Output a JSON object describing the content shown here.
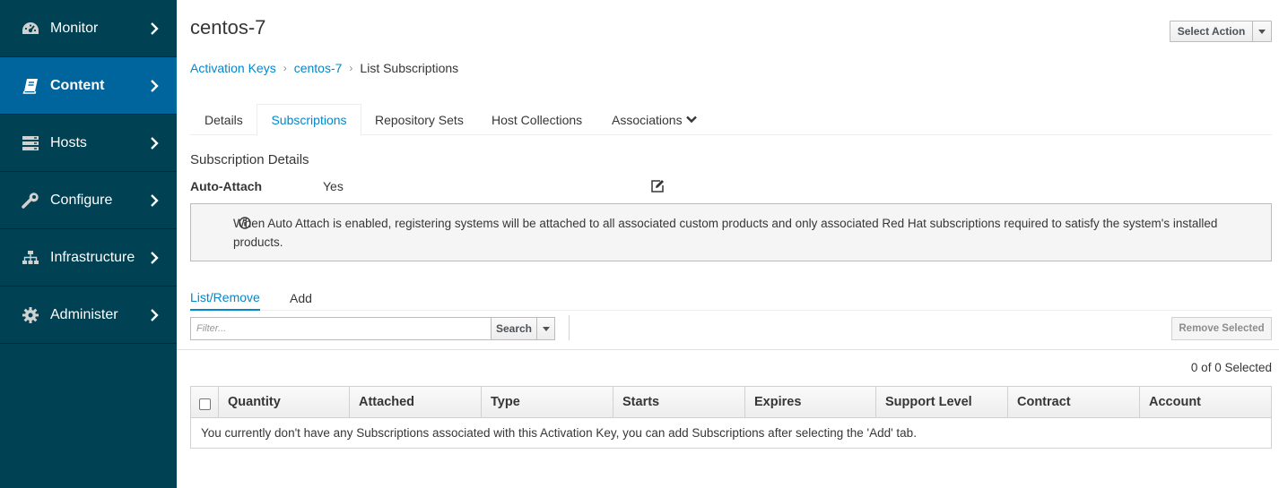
{
  "sidebar": {
    "items": [
      {
        "label": "Monitor",
        "icon": "dashboard-icon"
      },
      {
        "label": "Content",
        "icon": "book-icon",
        "active": true
      },
      {
        "label": "Hosts",
        "icon": "server-icon"
      },
      {
        "label": "Configure",
        "icon": "wrench-icon"
      },
      {
        "label": "Infrastructure",
        "icon": "sitemap-icon"
      },
      {
        "label": "Administer",
        "icon": "gear-icon"
      }
    ]
  },
  "header": {
    "title": "centos-7",
    "select_action": "Select Action"
  },
  "breadcrumb": {
    "items": [
      "Activation Keys",
      "centos-7"
    ],
    "current": "List Subscriptions",
    "separator": "›"
  },
  "tabs": {
    "items": [
      "Details",
      "Subscriptions",
      "Repository Sets",
      "Host Collections",
      "Associations"
    ],
    "active": "Subscriptions"
  },
  "subscription_details": {
    "heading": "Subscription Details",
    "auto_attach_label": "Auto-Attach",
    "auto_attach_value": "Yes",
    "info_text": "When Auto Attach is enabled, registering systems will be attached to all associated custom products and only associated Red Hat subscriptions required to satisfy the system's installed products."
  },
  "subtabs": {
    "items": [
      "List/Remove",
      "Add"
    ],
    "active": "List/Remove"
  },
  "filter": {
    "placeholder": "Filter...",
    "search_label": "Search",
    "remove_label": "Remove Selected"
  },
  "table": {
    "selected_text": "0 of 0 Selected",
    "columns": [
      "Quantity",
      "Attached",
      "Type",
      "Starts",
      "Expires",
      "Support Level",
      "Contract",
      "Account"
    ],
    "empty_message": "You currently don't have any Subscriptions associated with this Activation Key, you can add Subscriptions after selecting the 'Add' tab."
  },
  "colors": {
    "sidebar_bg": "#004153",
    "sidebar_active": "#00659c",
    "link": "#0088ce"
  }
}
